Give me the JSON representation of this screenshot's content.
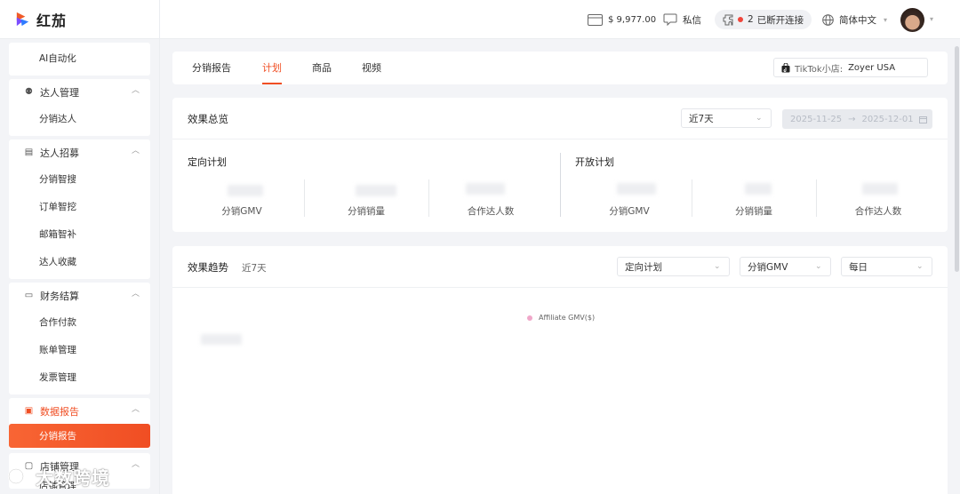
{
  "brand": {
    "name": "红茄"
  },
  "header": {
    "balance": "$ 9,977.00",
    "messages": "私信",
    "connection_count": "2",
    "connection_status": "已断开连接",
    "language": "简体中文"
  },
  "sidebar": {
    "groups": [
      {
        "title": "",
        "items": [
          "AI自动化"
        ]
      },
      {
        "title": "达人管理",
        "items": [
          "分销达人"
        ]
      },
      {
        "title": "达人招募",
        "items": [
          "分销智搜",
          "订单智挖",
          "邮箱智补",
          "达人收藏"
        ]
      },
      {
        "title": "财务结算",
        "items": [
          "合作付款",
          "账单管理",
          "发票管理"
        ]
      },
      {
        "title": "数据报告",
        "items": [
          "分销报告"
        ]
      },
      {
        "title": "店铺管理",
        "items": [
          "店铺管理"
        ]
      }
    ],
    "active_item": "分销报告"
  },
  "tabs": {
    "items": [
      "分销报告",
      "计划",
      "商品",
      "视频"
    ],
    "active": "计划",
    "shop_label": "TikTok小店:",
    "shop_value": "Zoyer USA"
  },
  "overview": {
    "title": "效果总览",
    "range_select": "近7天",
    "date_start": "2025-11-25",
    "date_sep": "→",
    "date_end": "2025-12-01",
    "sections": [
      {
        "title": "定向计划",
        "metrics": [
          "分销GMV",
          "分销销量",
          "合作达人数"
        ]
      },
      {
        "title": "开放计划",
        "metrics": [
          "分销GMV",
          "分销销量",
          "合作达人数"
        ]
      }
    ]
  },
  "trend": {
    "title": "效果趋势",
    "subtitle": "近7天",
    "plan_select": "定向计划",
    "metric_select": "分销GMV",
    "granularity_select": "每日",
    "legend": "Affiliate GMV($)"
  },
  "watermark": "大数跨境",
  "colors": {
    "accent": "#f04e23",
    "legend_dot": "#f0a7c9",
    "connection_dot": "#f0453a"
  }
}
